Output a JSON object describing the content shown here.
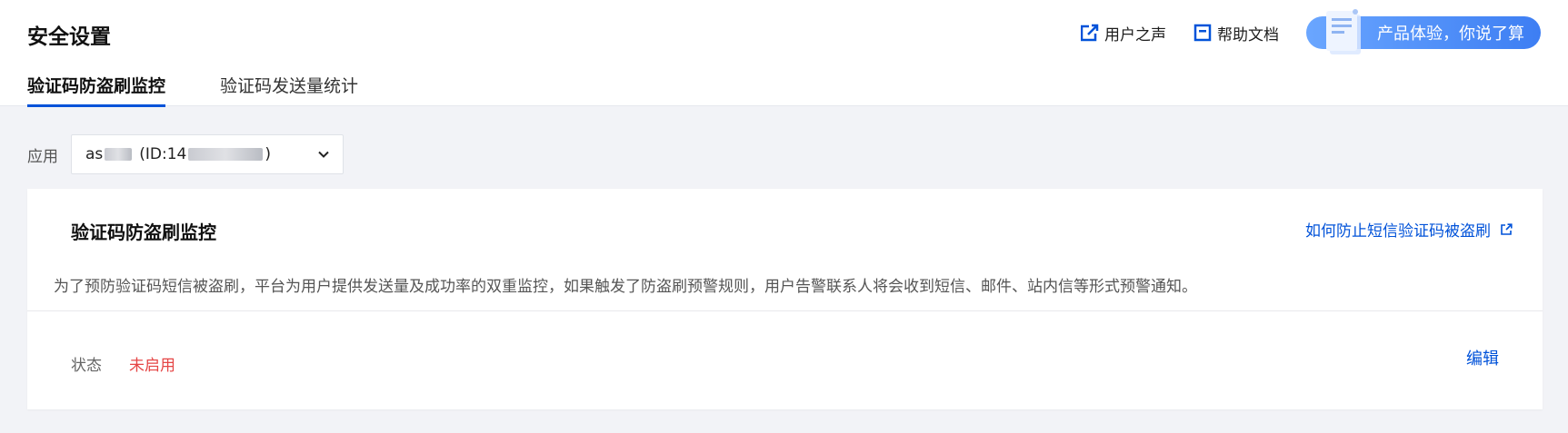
{
  "header": {
    "title": "安全设置",
    "links": [
      {
        "label": "用户之声",
        "icon": "external-edit-icon"
      },
      {
        "label": "帮助文档",
        "icon": "document-icon"
      }
    ],
    "feedback_button": "产品体验，你说了算"
  },
  "tabs": [
    {
      "label": "验证码防盗刷监控",
      "active": true
    },
    {
      "label": "验证码发送量统计",
      "active": false
    }
  ],
  "app_selector": {
    "label": "应用",
    "value_prefix": "as",
    "value_id_prefix": "(ID:14",
    "value_suffix": ")"
  },
  "card": {
    "title": "验证码防盗刷监控",
    "help_link": "如何防止短信验证码被盗刷",
    "description": "为了预防验证码短信被盗刷，平台为用户提供发送量及成功率的双重监控，如果触发了防盗刷预警规则，用户告警联系人将会收到短信、邮件、站内信等形式预警通知。",
    "status_label": "状态",
    "status_value": "未启用",
    "edit_label": "编辑"
  },
  "colors": {
    "accent": "#0052d9",
    "status_disabled": "#e54545",
    "page_bg": "#f2f3f7"
  }
}
